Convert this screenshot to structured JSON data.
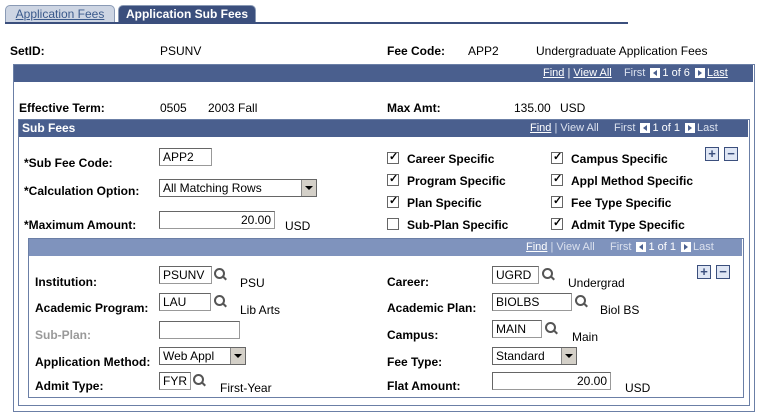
{
  "tabs": [
    {
      "label": "Application Fees",
      "active": false
    },
    {
      "label": "Application Sub Fees",
      "active": true
    }
  ],
  "header": {
    "setid_label": "SetID:",
    "setid_value": "PSUNV",
    "fee_code_label": "Fee Code:",
    "fee_code_value": "APP2",
    "fee_code_desc": "Undergraduate Application Fees"
  },
  "outer_nav": {
    "find": "Find",
    "view_all": "View All",
    "first": "First",
    "count": "1 of 6",
    "last": "Last"
  },
  "term": {
    "effective_term_label": "Effective Term:",
    "effective_term_code": "0505",
    "effective_term_desc": "2003 Fall",
    "max_amt_label": "Max Amt:",
    "max_amt_value": "135.00",
    "max_amt_currency": "USD"
  },
  "sub_fees": {
    "title": "Sub Fees",
    "nav": {
      "find": "Find",
      "view_all": "View All",
      "first": "First",
      "count": "1 of 1",
      "last": "Last"
    },
    "sub_fee_code_label": "*Sub Fee Code:",
    "sub_fee_code_value": "APP2",
    "calc_option_label": "*Calculation Option:",
    "calc_option_value": "All Matching Rows",
    "max_amount_label": "*Maximum Amount:",
    "max_amount_value": "20.00",
    "max_amount_currency": "USD",
    "checkboxes": [
      {
        "label": "Career Specific",
        "checked": true
      },
      {
        "label": "Campus Specific",
        "checked": true
      },
      {
        "label": "Program Specific",
        "checked": true
      },
      {
        "label": "Appl Method Specific",
        "checked": true
      },
      {
        "label": "Plan Specific",
        "checked": true
      },
      {
        "label": "Fee Type Specific",
        "checked": true
      },
      {
        "label": "Sub-Plan Specific",
        "checked": false
      },
      {
        "label": "Admit Type Specific",
        "checked": true
      }
    ]
  },
  "detail": {
    "nav": {
      "find": "Find",
      "view_all": "View All",
      "first": "First",
      "count": "1 of 1",
      "last": "Last"
    },
    "institution_label": "Institution:",
    "institution_value": "PSUNV",
    "institution_desc": "PSU",
    "career_label": "Career:",
    "career_value": "UGRD",
    "career_desc": "Undergrad",
    "acad_program_label": "Academic Program:",
    "acad_program_value": "LAU",
    "acad_program_desc": "Lib Arts",
    "acad_plan_label": "Academic Plan:",
    "acad_plan_value": "BIOLBS",
    "acad_plan_desc": "Biol BS",
    "sub_plan_label": "Sub-Plan:",
    "sub_plan_value": "",
    "campus_label": "Campus:",
    "campus_value": "MAIN",
    "campus_desc": "Main",
    "app_method_label": "Application Method:",
    "app_method_value": "Web Appl",
    "fee_type_label": "Fee Type:",
    "fee_type_value": "Standard",
    "admit_type_label": "Admit Type:",
    "admit_type_value": "FYR",
    "admit_type_desc": "First-Year",
    "flat_amount_label": "Flat Amount:",
    "flat_amount_value": "20.00",
    "flat_amount_currency": "USD"
  }
}
